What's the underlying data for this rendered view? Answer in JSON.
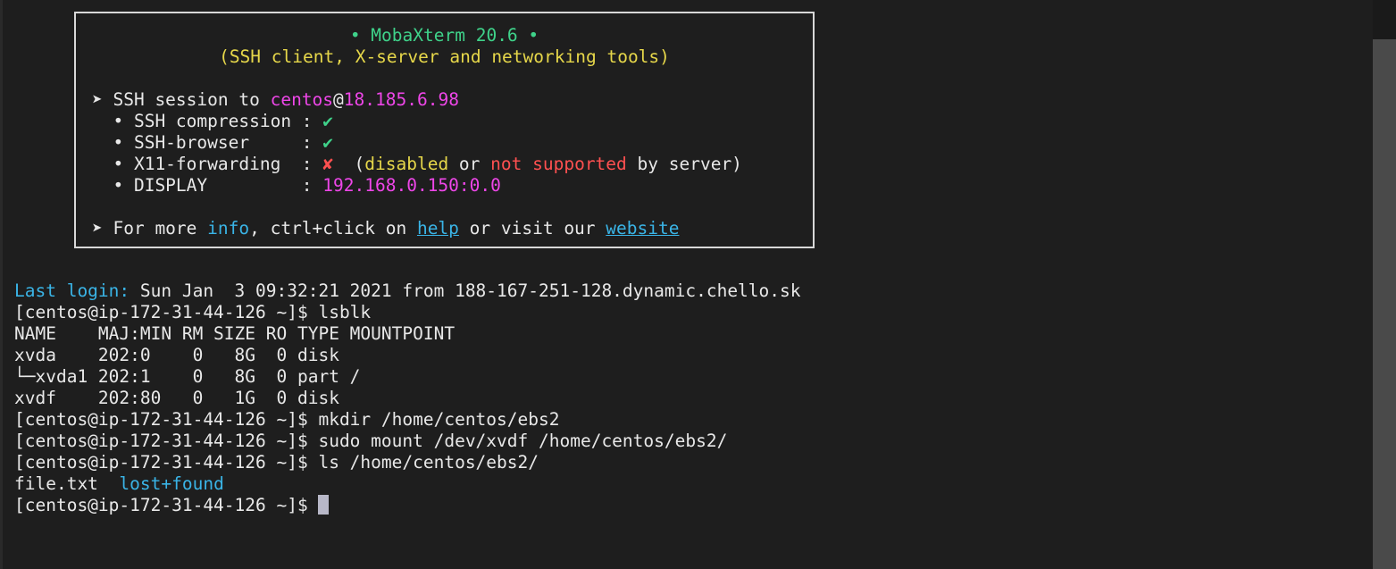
{
  "banner": {
    "title": "• MobaXterm 20.6 •",
    "subtitle": "(SSH client, X-server and networking tools)",
    "session_prefix": "➤ SSH session to ",
    "session_user": "centos",
    "session_at": "@",
    "session_host": "18.185.6.98",
    "compression_label": "  • SSH compression : ",
    "compression_status": "✔",
    "browser_label": "  • SSH-browser     : ",
    "browser_status": "✔",
    "x11_label": "  • X11-forwarding  : ",
    "x11_status": "✘",
    "x11_open": "  (",
    "x11_disabled": "disabled",
    "x11_or": " or ",
    "x11_not_supported": "not supported",
    "x11_by_server": " by server)",
    "display_label": "  • DISPLAY         : ",
    "display_value": "192.168.0.150:0.0",
    "info_prefix": "➤ For more ",
    "info_word": "info",
    "info_mid": ", ctrl+click on ",
    "help_link": "help",
    "visit_text": " or visit our ",
    "website_link": "website"
  },
  "terminal": {
    "last_login_label": "Last login:",
    "last_login_text": " Sun Jan  3 09:32:21 2021 from 188-167-251-128.dynamic.chello.sk",
    "lines": [
      "[centos@ip-172-31-44-126 ~]$ lsblk",
      "NAME    MAJ:MIN RM SIZE RO TYPE MOUNTPOINT",
      "xvda    202:0    0   8G  0 disk",
      "└─xvda1 202:1    0   8G  0 part /",
      "xvdf    202:80   0   1G  0 disk",
      "[centos@ip-172-31-44-126 ~]$ mkdir /home/centos/ebs2",
      "[centos@ip-172-31-44-126 ~]$ sudo mount /dev/xvdf /home/centos/ebs2/",
      "[centos@ip-172-31-44-126 ~]$ ls /home/centos/ebs2/"
    ],
    "ls_file": "file.txt",
    "ls_gap": "  ",
    "ls_dir": "lost+found",
    "prompt": "[centos@ip-172-31-44-126 ~]$ "
  },
  "colors": {
    "background": "#1e1e1e",
    "green": "#3fd28a",
    "yellow": "#e6d74a",
    "magenta": "#ee46e8",
    "cyan": "#3ab4e6",
    "red": "#ff5050"
  }
}
